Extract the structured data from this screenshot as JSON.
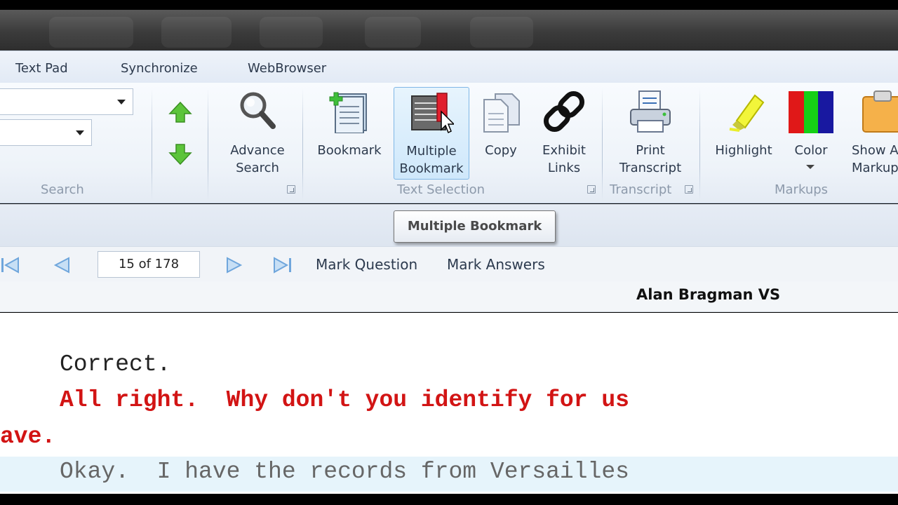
{
  "tabs": [
    {
      "label": "Text Pad"
    },
    {
      "label": "Synchronize"
    },
    {
      "label": "WebBrowser"
    }
  ],
  "ribbon": {
    "groups": {
      "search": "Search",
      "text_selection": "Text Selection",
      "transcript": "Transcript",
      "markups": "Markups"
    },
    "buttons": {
      "advance_search": "Advance\nSearch",
      "bookmark": "Bookmark",
      "multiple_bookmark": "Multiple\nBookmark",
      "copy": "Copy",
      "exhibit_links": "Exhibit\nLinks",
      "print_transcript": "Print\nTranscript",
      "highlight": "Highlight",
      "color": "Color",
      "show_markup": "Show A\nMarkup"
    }
  },
  "tooltip": "Multiple Bookmark",
  "navigation": {
    "page_indicator": "15 of 178",
    "mark_question": "Mark Question",
    "mark_answers": "Mark Answers"
  },
  "witness": "Alan Bragman VS",
  "transcript": {
    "lines": [
      {
        "text": "Correct.",
        "style": "answer"
      },
      {
        "text": "All right.  Why don't you identify for us",
        "style": "question"
      },
      {
        "text": "ave.",
        "style": "question"
      },
      {
        "text": "Okay.  I have the records from Versailles",
        "style": "answer-highlighted"
      }
    ]
  },
  "colors": {
    "question_text": "#d21414",
    "answer_text": "#222222",
    "ribbon_background": "#eef3f9",
    "active_button": "#cfe8fb"
  },
  "icons": {
    "up": "green-up-arrow-icon",
    "down": "green-down-arrow-icon",
    "search": "magnifier-icon",
    "bookmark": "bookmark-plus-icon",
    "multiple_bookmark": "multiple-bookmark-icon",
    "copy": "copy-icon",
    "exhibit": "chain-link-icon",
    "print": "printer-icon",
    "highlight": "highlighter-icon",
    "color": "color-bars-icon",
    "markup": "clipboard-icon"
  }
}
